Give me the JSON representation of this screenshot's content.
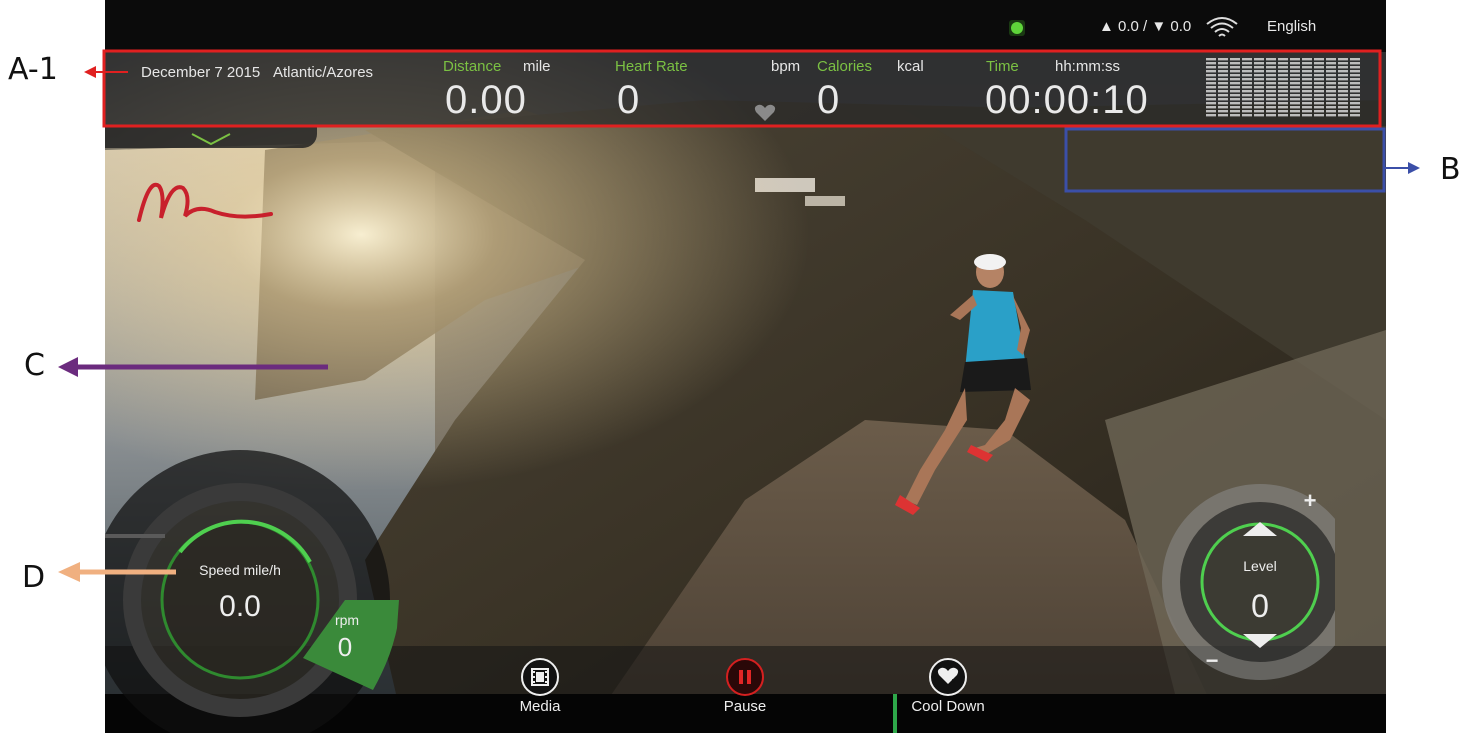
{
  "callouts": {
    "a1": "A-1",
    "b": "B",
    "c": "C",
    "d": "D"
  },
  "status": {
    "incline_readout": "▲ 0.0 / ▼ 0.0",
    "language": "English"
  },
  "header": {
    "date": "December 7 2015",
    "timezone": "Atlantic/Azores"
  },
  "metrics": {
    "distance": {
      "label": "Distance",
      "unit": "mile",
      "value": "0.00"
    },
    "heart_rate": {
      "label": "Heart Rate",
      "unit": "bpm",
      "value": "0"
    },
    "calories": {
      "label": "Calories",
      "unit": "kcal",
      "value": "0"
    },
    "time": {
      "label": "Time",
      "unit": "hh:mm:ss",
      "value": "00:00:10"
    }
  },
  "speed_gauge": {
    "label": "Speed mile/h",
    "value": "0.0"
  },
  "rpm_gauge": {
    "label": "rpm",
    "value": "0"
  },
  "level_gauge": {
    "label": "Level",
    "value": "0",
    "plus": "+",
    "minus": "−"
  },
  "nav": {
    "media": "Media",
    "pause": "Pause",
    "cool_down": "Cool Down"
  },
  "colors": {
    "accent_green": "#7bc143",
    "callout_red": "#e02020",
    "callout_blue": "#3b4fa8",
    "callout_purple": "#6b2b7e",
    "callout_orange": "#f0b080",
    "pause_red": "#d42020"
  },
  "icons": [
    "wifi-icon",
    "heart-icon",
    "film-icon",
    "pause-icon",
    "heart-down-icon",
    "chevron-down-icon",
    "status-led-icon",
    "logo-icon"
  ]
}
